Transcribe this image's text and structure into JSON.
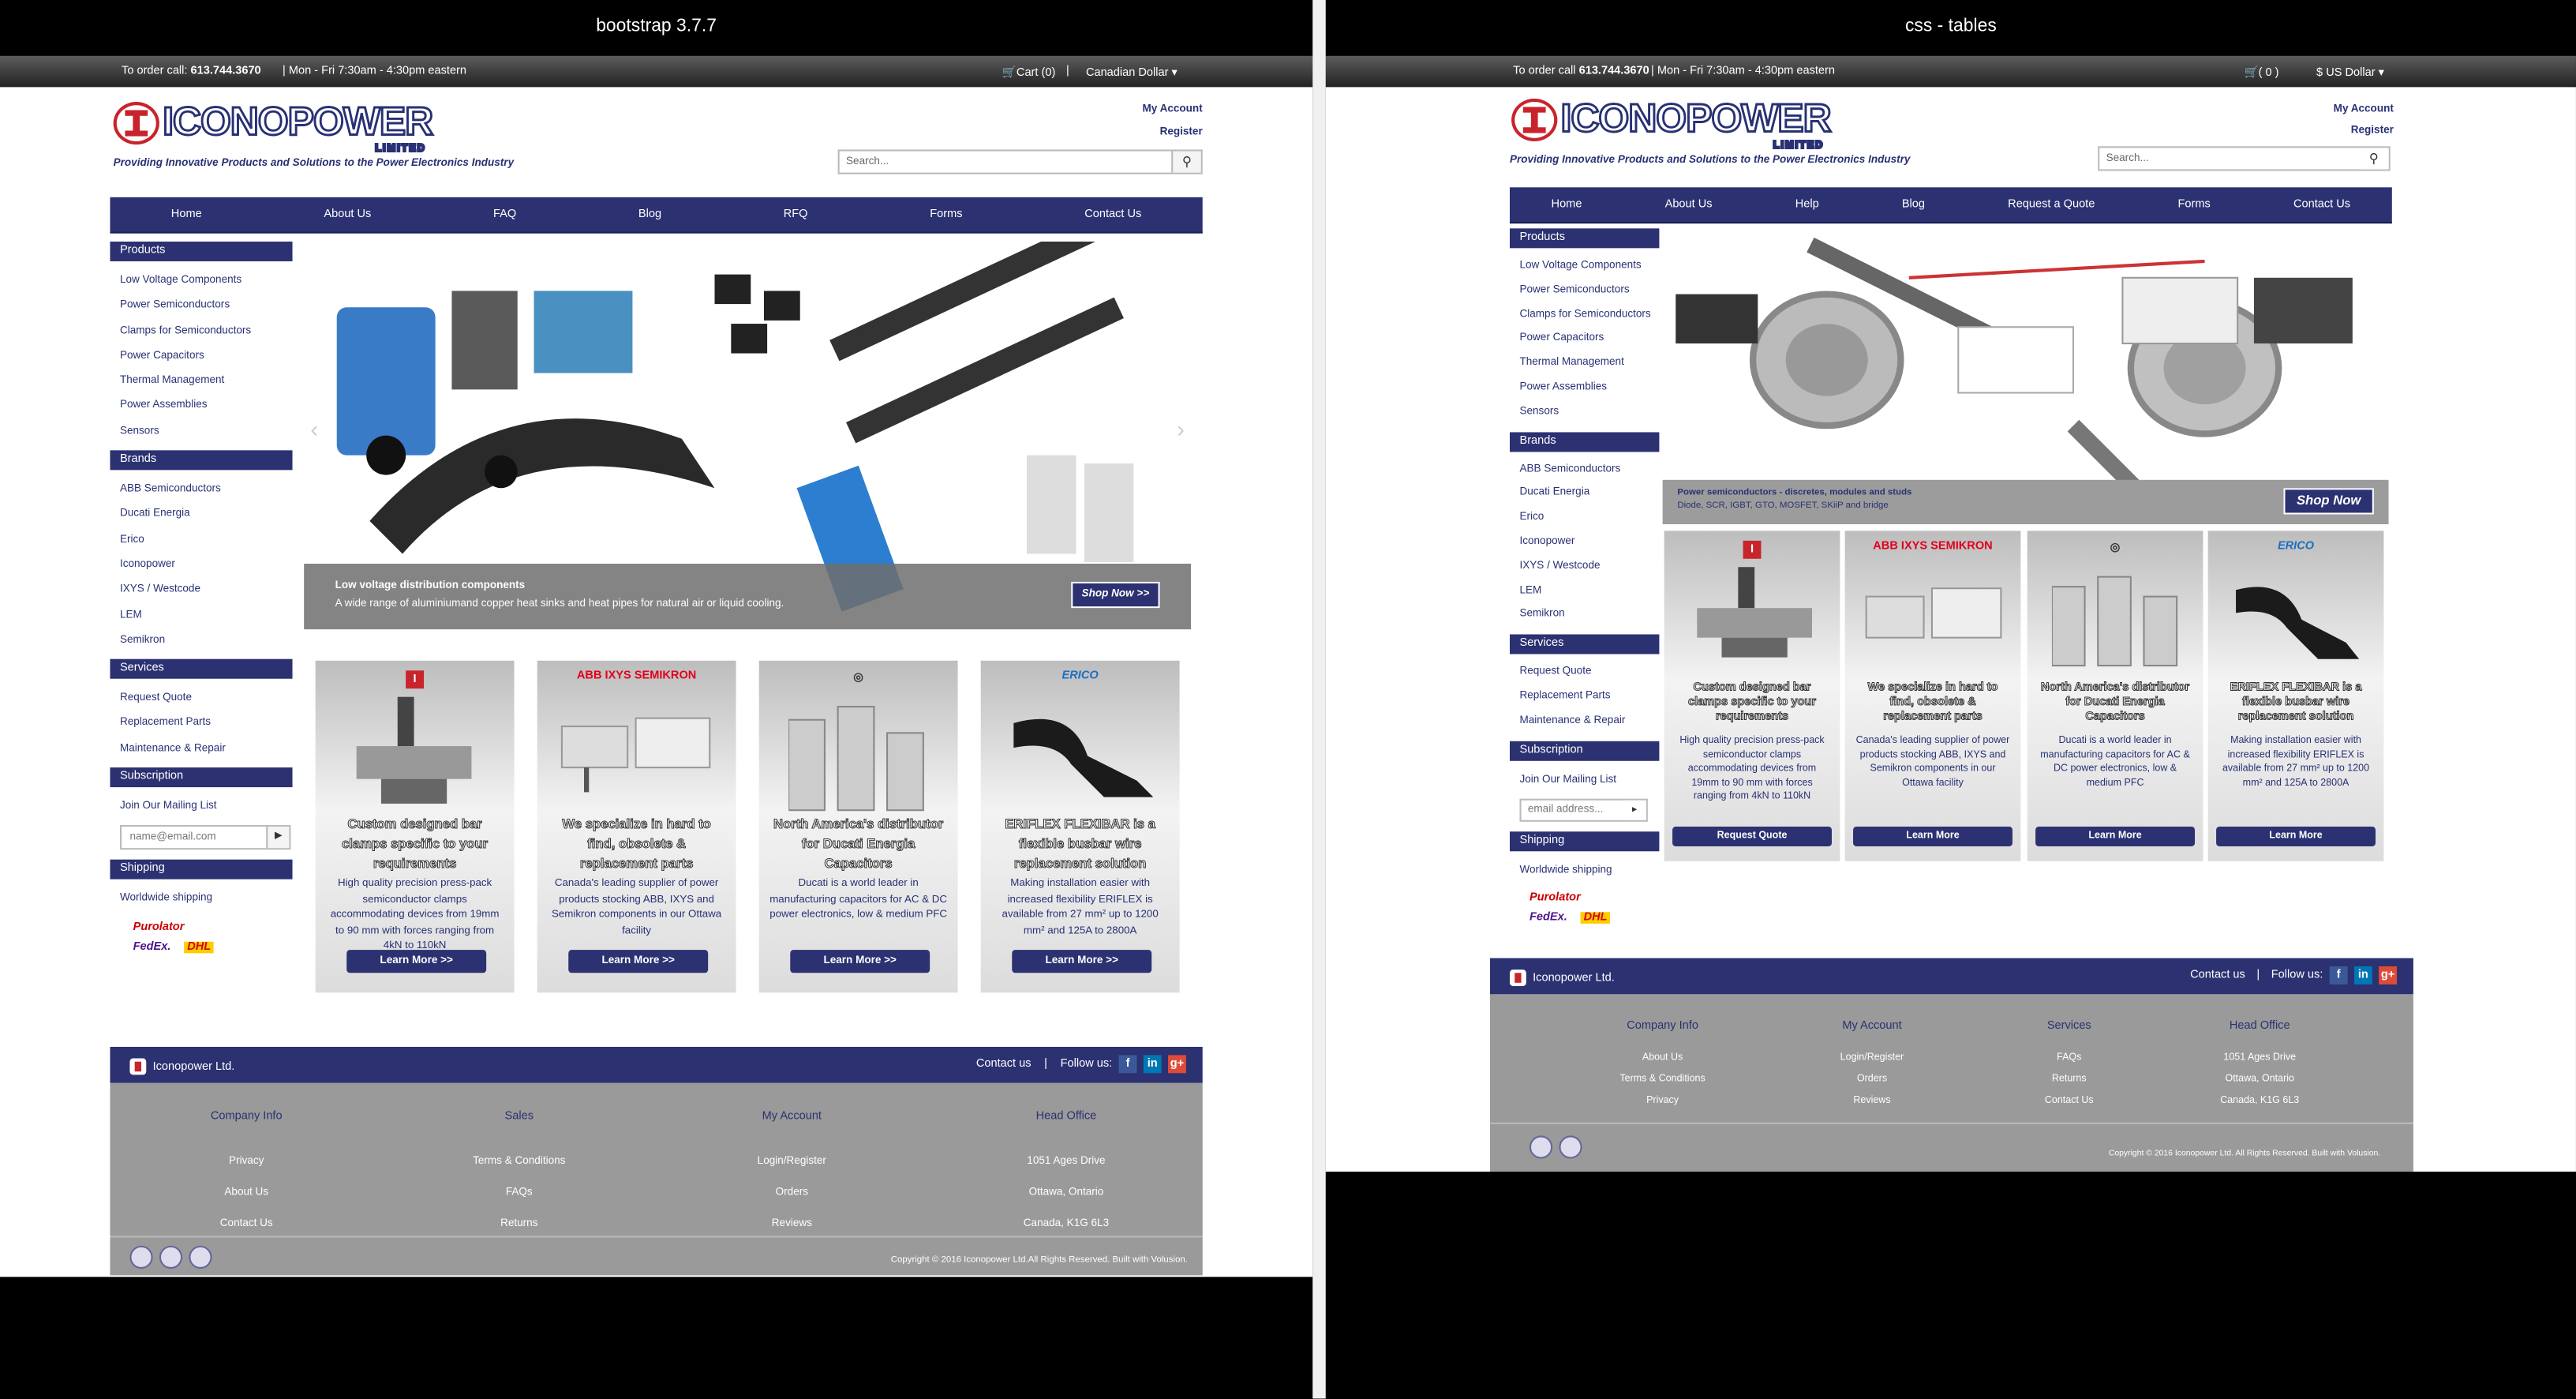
{
  "left": {
    "caption": "bootstrap  3.7.7",
    "topbar": {
      "order_label": "To order call:",
      "phone": "613.744.3670",
      "hours": "|   Mon - Fri   7:30am - 4:30pm eastern",
      "cart": "Cart (0)",
      "sep": "|",
      "currency": "Canadian Dollar"
    },
    "header": {
      "brand": "ICONOPOWER",
      "brand_sub": "LIMITED",
      "tagline": "Providing Innovative Products and Solutions to the Power Electronics Industry",
      "my_account": "My Account",
      "register": "Register",
      "search_placeholder": "Search..."
    },
    "nav": [
      "Home",
      "About Us",
      "FAQ",
      "Blog",
      "RFQ",
      "Forms",
      "Contact Us"
    ],
    "sidebar": {
      "products": {
        "title": "Products",
        "items": [
          "Low Voltage Components",
          "Power Semiconductors",
          "Clamps for Semiconductors",
          "Power Capacitors",
          "Thermal Management",
          "Power Assemblies",
          "Sensors"
        ]
      },
      "brands": {
        "title": "Brands",
        "items": [
          "ABB Semiconductors",
          "Ducati Energia",
          "Erico",
          "Iconopower",
          "IXYS / Westcode",
          "LEM",
          "Semikron"
        ]
      },
      "services": {
        "title": "Services",
        "items": [
          "Request Quote",
          "Replacement Parts",
          "Maintenance & Repair"
        ]
      },
      "subscription": {
        "title": "Subscription",
        "item": "Join Our Mailing List",
        "placeholder": "name@email.com"
      },
      "shipping": {
        "title": "Shipping",
        "item": "Worldwide shipping",
        "carriers": [
          "Purolator",
          "FedEx.",
          "DHL"
        ]
      }
    },
    "hero": {
      "title": "Low voltage distribution components",
      "desc": "A wide range of aluminiumand copper heat sinks and heat pipes for natural air or liquid cooling.",
      "cta": "Shop Now >>"
    },
    "cards": [
      {
        "brand": "Iconopower",
        "head": "Custom designed bar clamps specific to your requirements",
        "body": "High quality precision press-pack semiconductor clamps accommodating devices from 19mm to 90 mm with forces ranging from 4kN to 110kN",
        "btn": "Learn More >>"
      },
      {
        "brand": "ABB IXYS SEMIKRON",
        "head": "We specialize in hard to find, obsolete & replacement parts",
        "body": "Canada's leading supplier of power products stocking ABB, IXYS and Semikron components in our Ottawa facility",
        "btn": "Learn More >>"
      },
      {
        "brand": "Ducati",
        "head": "North America's distributor for Ducati Energia Capacitors",
        "body": "Ducati is a world leader in manufacturing capacitors for AC & DC power electronics, low & medium PFC",
        "btn": "Learn More >>"
      },
      {
        "brand": "ERICO",
        "head": "ERIFLEX FLEXIBAR is a flexible busbar wire replacement solution",
        "body": "Making installation easier with increased flexibility ERIFLEX is available from 27 mm² up to 1200 mm² and 125A to 2800A",
        "btn": "Learn More >>"
      }
    ],
    "footer": {
      "company": "Iconopower Ltd.",
      "contact": "Contact us",
      "sep": "|",
      "follow": "Follow us:",
      "cols": [
        {
          "title": "Company Info",
          "items": [
            "Privacy",
            "About Us",
            "Contact Us"
          ]
        },
        {
          "title": "Sales",
          "items": [
            "Terms & Conditions",
            "FAQs",
            "Returns"
          ]
        },
        {
          "title": "My Account",
          "items": [
            "Login/Register",
            "Orders",
            "Reviews"
          ]
        },
        {
          "title": "Head Office",
          "items": [
            "1051 Ages Drive",
            "Ottawa, Ontario",
            "Canada, K1G 6L3"
          ]
        }
      ],
      "copyright": "Copyright © 2016 Iconopower Ltd.All Rights Reserved. Built with Volusion."
    }
  },
  "right": {
    "caption": "css - tables",
    "topbar": {
      "order_label": "To order call",
      "phone": "613.744.3670",
      "hours": "|   Mon - Fri   7:30am - 4:30pm eastern",
      "cart": "( 0 )",
      "currency": "$  US Dollar"
    },
    "header": {
      "brand": "ICONOPOWER",
      "brand_sub": "LIMITED",
      "tagline": "Providing Innovative Products and Solutions to the Power Electronics Industry",
      "my_account": "My Account",
      "register": "Register",
      "search_placeholder": "Search..."
    },
    "nav": [
      "Home",
      "About Us",
      "Help",
      "Blog",
      "Request a Quote",
      "Forms",
      "Contact Us"
    ],
    "sidebar": {
      "products": {
        "title": "Products",
        "items": [
          "Low Voltage Components",
          "Power Semiconductors",
          "Clamps for Semiconductors",
          "Power Capacitors",
          "Thermal Management",
          "Power Assemblies",
          "Sensors"
        ]
      },
      "brands": {
        "title": "Brands",
        "items": [
          "ABB Semiconductors",
          "Ducati Energia",
          "Erico",
          "Iconopower",
          "IXYS / Westcode",
          "LEM",
          "Semikron"
        ]
      },
      "services": {
        "title": "Services",
        "items": [
          "Request Quote",
          "Replacement Parts",
          "Maintenance & Repair"
        ]
      },
      "subscription": {
        "title": "Subscription",
        "item": "Join Our Mailing List",
        "placeholder": "email address..."
      },
      "shipping": {
        "title": "Shipping",
        "item": "Worldwide shipping",
        "carriers": [
          "Purolator",
          "FedEx.",
          "DHL"
        ]
      }
    },
    "hero": {
      "title": "Power semiconductors - discretes, modules and studs",
      "desc": "Diode, SCR, IGBT, GTO, MOSFET, SKiiP and bridge",
      "cta": "Shop Now"
    },
    "cards": [
      {
        "brand": "Iconopower",
        "head": "Custom designed bar clamps specific to your requirements",
        "body": "High quality precision press-pack semiconductor clamps accommodating devices from 19mm to 90 mm with forces ranging from 4kN to 110kN",
        "btn": "Request Quote"
      },
      {
        "brand": "ABB IXYS SEMIKRON",
        "head": "We specialize in hard to find, obsolete & replacement parts",
        "body": "Canada's leading supplier of power products stocking ABB, IXYS and Semikron components in our Ottawa facility",
        "btn": "Learn More"
      },
      {
        "brand": "Ducati",
        "head": "North America's distributor for Ducati Energia Capacitors",
        "body": "Ducati is a world leader in manufacturing capacitors for AC & DC power electronics, low & medium PFC",
        "btn": "Learn More"
      },
      {
        "brand": "ERICO",
        "head": "ERIFLEX FLEXIBAR is a flexible busbar wire replacement solution",
        "body": "Making installation easier with increased flexibility ERIFLEX is available from 27 mm² up to 1200 mm² and 125A to 2800A",
        "btn": "Learn More"
      }
    ],
    "footer": {
      "company": "Iconopower Ltd.",
      "contact": "Contact us",
      "sep": "|",
      "follow": "Follow us:",
      "cols": [
        {
          "title": "Company Info",
          "items": [
            "About Us",
            "Terms & Conditions",
            "Privacy"
          ]
        },
        {
          "title": "My Account",
          "items": [
            "Login/Register",
            "Orders",
            "Reviews"
          ]
        },
        {
          "title": "Services",
          "items": [
            "FAQs",
            "Returns",
            "Contact Us"
          ]
        },
        {
          "title": "Head Office",
          "items": [
            "1051 Ages Drive",
            "Ottawa, Ontario",
            "Canada, K1G 6L3"
          ]
        }
      ],
      "copyright": "Copyright © 2016 Iconopower Ltd. All Rights Reserved. Built with Volusion."
    }
  },
  "colors": {
    "navy": "#2b3171",
    "brand_red": "#c8242b",
    "footer_grey": "#9a9a9a"
  }
}
